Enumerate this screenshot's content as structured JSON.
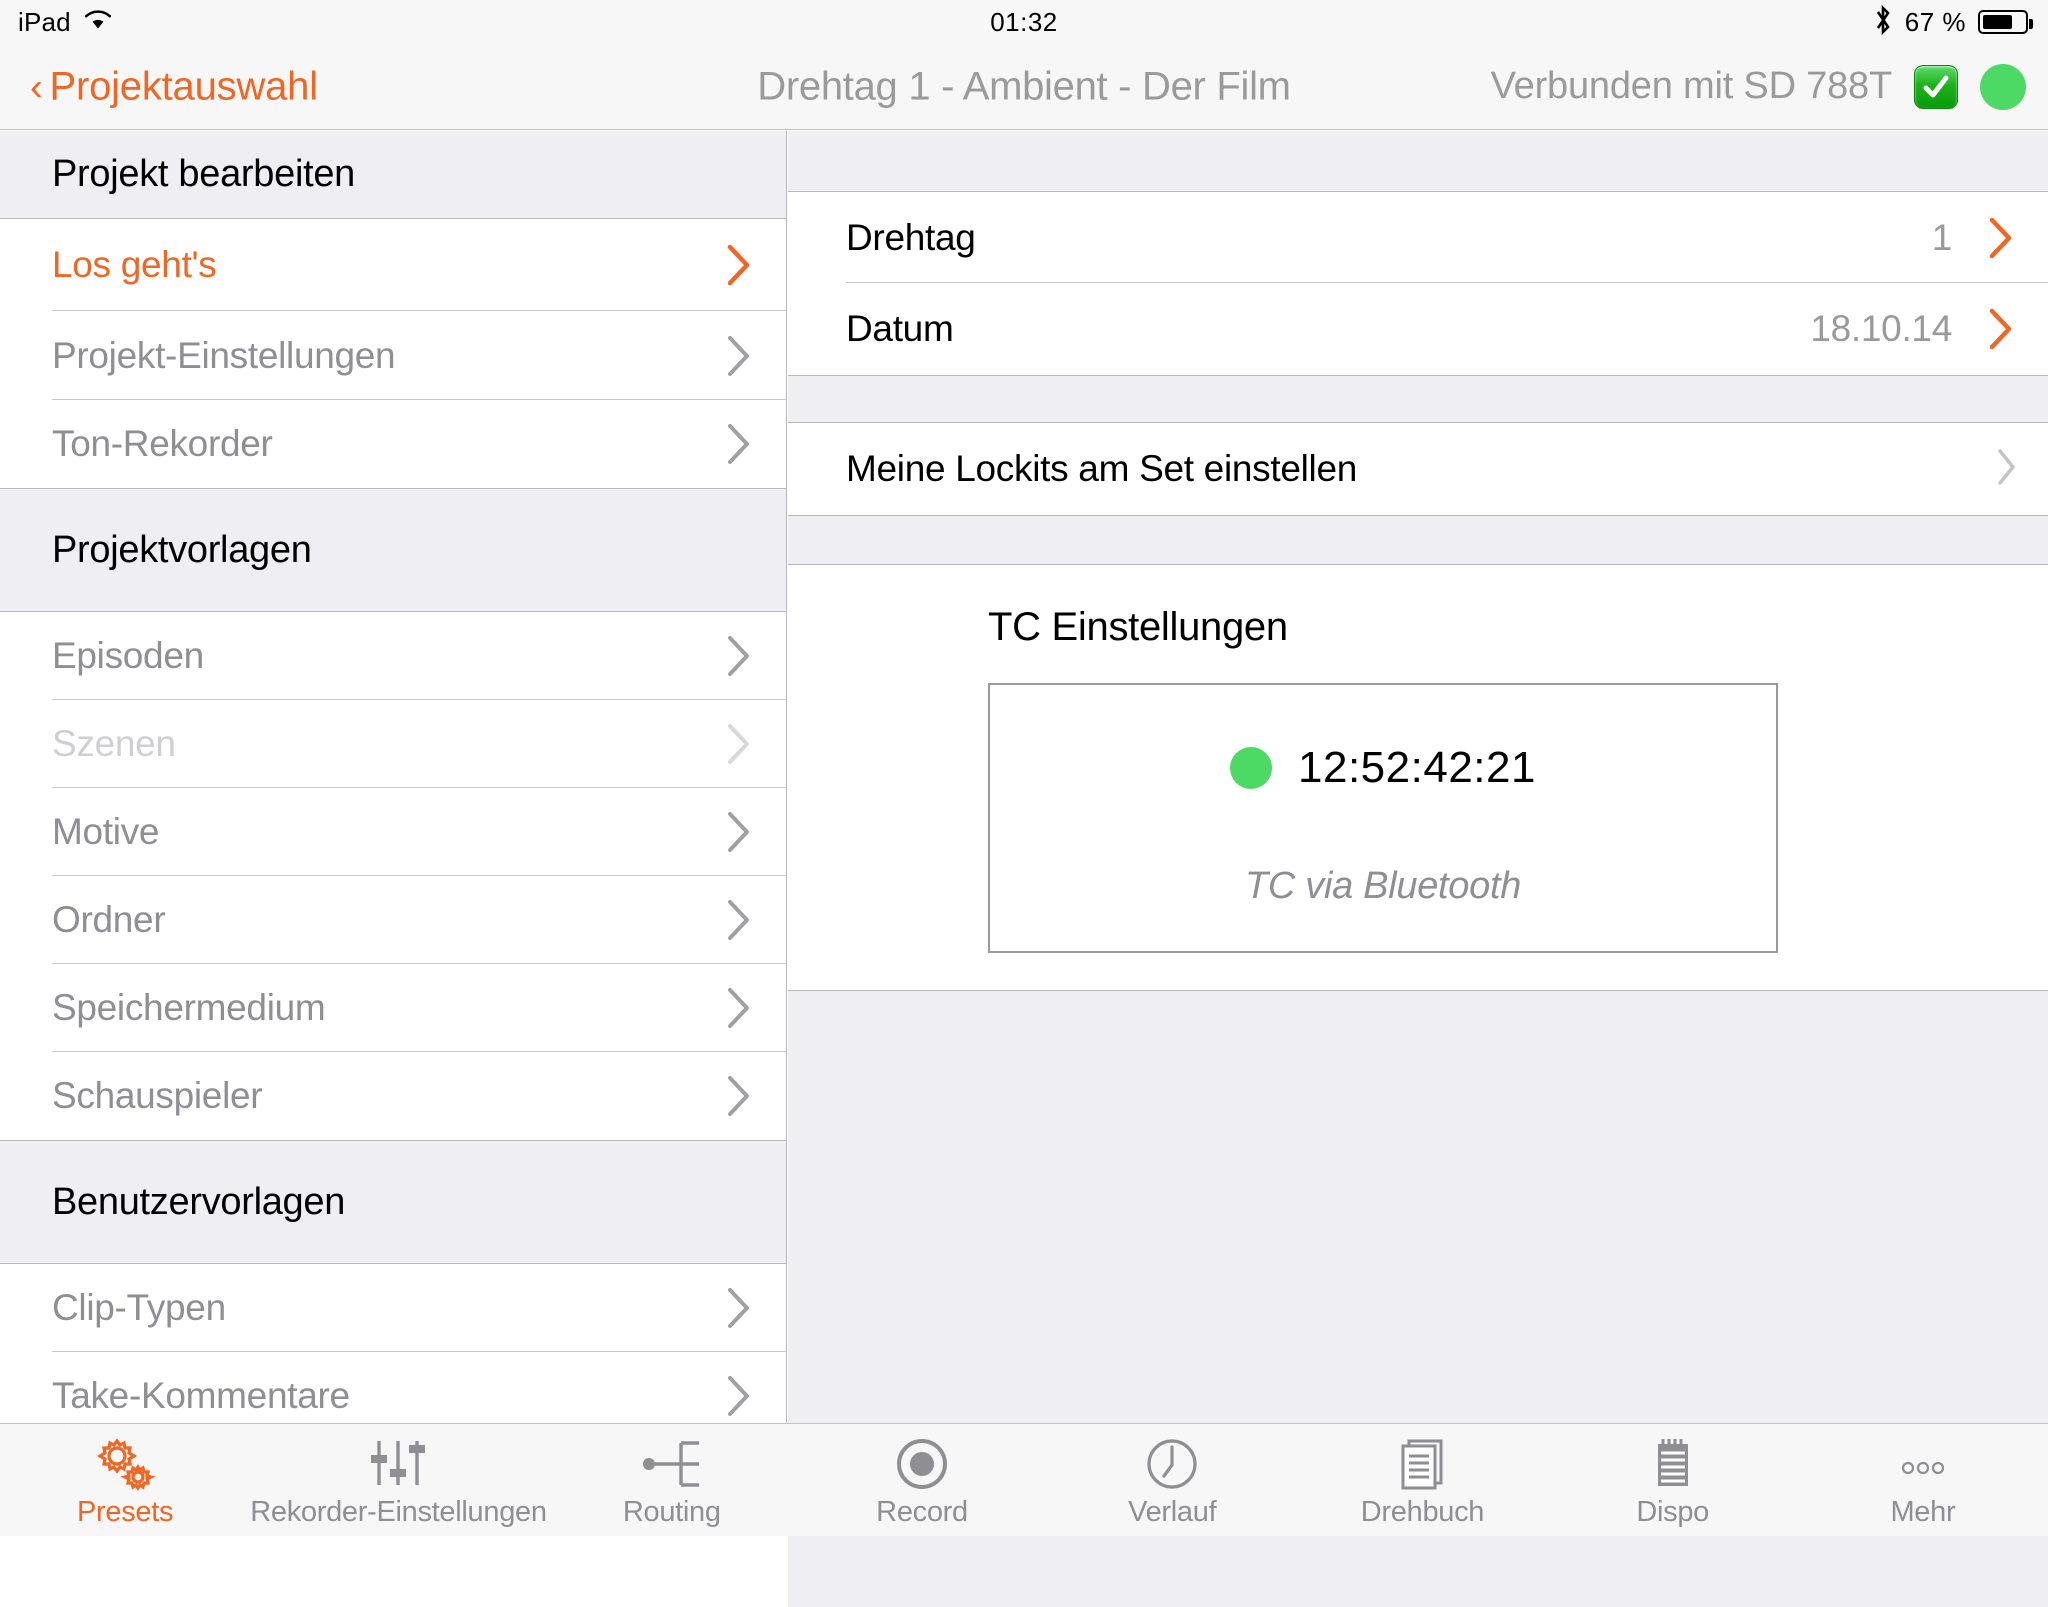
{
  "status_bar": {
    "device": "iPad",
    "wifi_icon": "wifi-icon",
    "time": "01:32",
    "bluetooth_icon": "bluetooth-icon",
    "battery_percent": "67 %",
    "battery_level": 67
  },
  "nav_bar": {
    "back_chevron": "‹",
    "back_label": "Projektauswahl",
    "title": "Drehtag 1 - Ambient - Der Film",
    "connection_label": "Verbunden mit SD 788T",
    "check_icon": "green-check-icon",
    "status_dot": "green-status-dot"
  },
  "colors": {
    "accent": "#f26522",
    "green": "#4cd964",
    "group_bg": "#eeeef3",
    "row_bg": "#ffffff",
    "separator": "#c9c9ce",
    "muted_text": "#8e8e93"
  },
  "sidebar": {
    "sections": [
      {
        "title": "Projekt bearbeiten",
        "items": [
          {
            "label": "Los geht's",
            "state": "selected"
          },
          {
            "label": "Projekt-Einstellungen",
            "state": "normal"
          },
          {
            "label": "Ton-Rekorder",
            "state": "normal"
          }
        ]
      },
      {
        "title": "Projektvorlagen",
        "items": [
          {
            "label": "Episoden",
            "state": "normal"
          },
          {
            "label": "Szenen",
            "state": "disabled"
          },
          {
            "label": "Motive",
            "state": "normal"
          },
          {
            "label": "Ordner",
            "state": "normal"
          },
          {
            "label": "Speichermedium",
            "state": "normal"
          },
          {
            "label": "Schauspieler",
            "state": "normal"
          }
        ]
      },
      {
        "title": "Benutzervorlagen",
        "items": [
          {
            "label": "Clip-Typen",
            "state": "normal"
          },
          {
            "label": "Take-Kommentare",
            "state": "normal"
          }
        ]
      }
    ]
  },
  "detail": {
    "rows": [
      {
        "label": "Drehtag",
        "value": "1",
        "chevron": "orange"
      },
      {
        "label": "Datum",
        "value": "18.10.14",
        "chevron": "orange"
      }
    ],
    "lockits_row": {
      "label": "Meine Lockits am Set einstellen",
      "chevron": "gray"
    },
    "tc": {
      "title": "TC Einstellungen",
      "timecode": "12:52:42:21",
      "source": "TC via Bluetooth",
      "status_dot": "green-status-dot"
    }
  },
  "tab_bar": {
    "tabs": [
      {
        "label": "Presets",
        "icon": "gears-icon",
        "active": true
      },
      {
        "label": "Rekorder-Einstellungen",
        "icon": "sliders-icon",
        "active": false
      },
      {
        "label": "Routing",
        "icon": "routing-icon",
        "active": false
      },
      {
        "label": "Record",
        "icon": "record-circle-icon",
        "active": false
      },
      {
        "label": "Verlauf",
        "icon": "clock-icon",
        "active": false
      },
      {
        "label": "Drehbuch",
        "icon": "documents-icon",
        "active": false
      },
      {
        "label": "Dispo",
        "icon": "notepad-icon",
        "active": false
      },
      {
        "label": "Mehr",
        "icon": "ellipsis-icon",
        "active": false
      }
    ]
  }
}
